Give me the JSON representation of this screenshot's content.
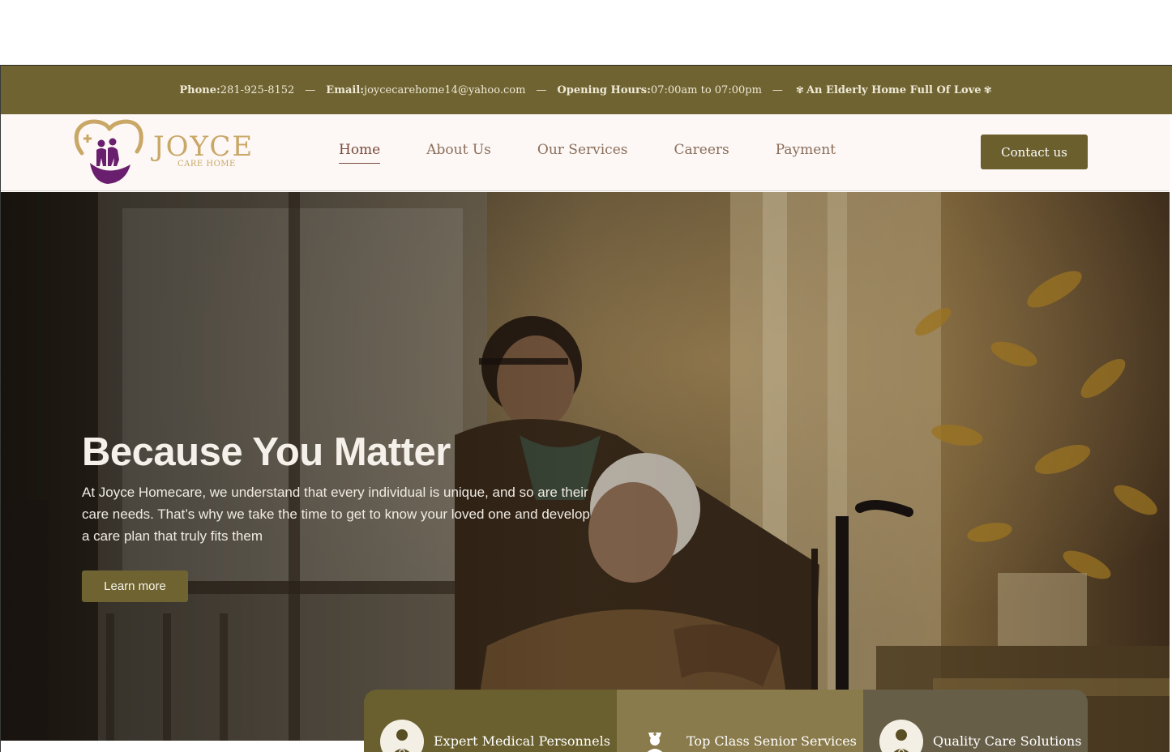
{
  "topbar": {
    "phone_label": "Phone:",
    "phone": "281-925-8152",
    "email_label": "Email:",
    "email": "joycecarehome14@yahoo.com",
    "hours_label": "Opening Hours:",
    "hours": "07:00am to 07:00pm",
    "tagline": "An Elderly Home Full Of Love",
    "separator": "—"
  },
  "logo": {
    "word": "JOYCE",
    "sub": "CARE HOME"
  },
  "nav": {
    "items": [
      "Home",
      "About Us",
      "Our Services",
      "Careers",
      "Payment"
    ],
    "active": "Home",
    "contact_label": "Contact us"
  },
  "hero": {
    "title": "Because You Matter",
    "description": "At Joyce Homecare, we understand that every individual is unique, and so are their care needs. That’s why we take the time to get to know your loved one and develop a care plan that truly fits them",
    "cta_label": "Learn more"
  },
  "features": [
    {
      "label": "Expert Medical Personnels",
      "icon": "doctor-icon"
    },
    {
      "label": "Top Class Senior Services",
      "icon": "nurse-icon"
    },
    {
      "label": "Quality Care Solutions",
      "icon": "doctor-icon"
    }
  ],
  "colors": {
    "brand_olive": "#6e6331",
    "nav_text": "#8a6e5a",
    "logo_gold": "#c9a766",
    "logo_purple": "#6a1f6e"
  }
}
